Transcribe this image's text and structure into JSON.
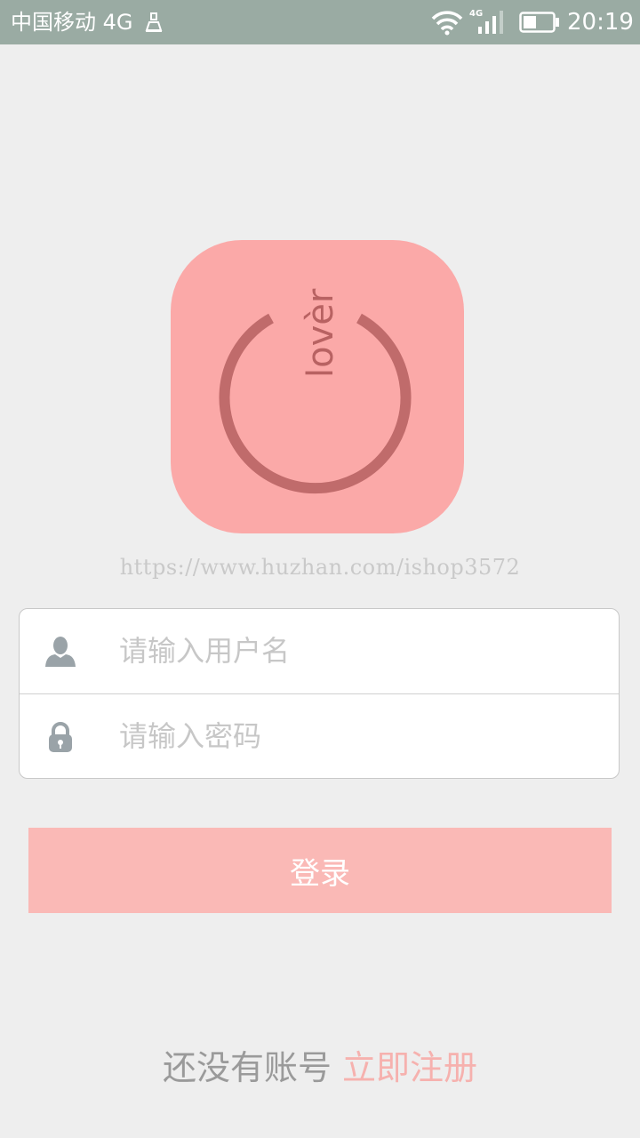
{
  "status_bar": {
    "carrier": "中国移动 4G",
    "network_badge": "4G",
    "time": "20:19",
    "icons": [
      "notification-icon",
      "wifi-icon",
      "signal-icon",
      "battery-icon"
    ]
  },
  "logo": {
    "brand_text": "lovèr",
    "background_color": "#fba9a8",
    "ring_color": "#c06b6b"
  },
  "watermark": "https://www.huzhan.com/ishop3572",
  "form": {
    "username_placeholder": "请输入用户名",
    "password_placeholder": "请输入密码",
    "username_icon": "user-icon",
    "password_icon": "lock-icon"
  },
  "login_button": {
    "label": "登录",
    "color": "#fab9b6"
  },
  "footer": {
    "question": "还没有账号",
    "register_link": "立即注册",
    "link_color": "#f6b1ae"
  }
}
